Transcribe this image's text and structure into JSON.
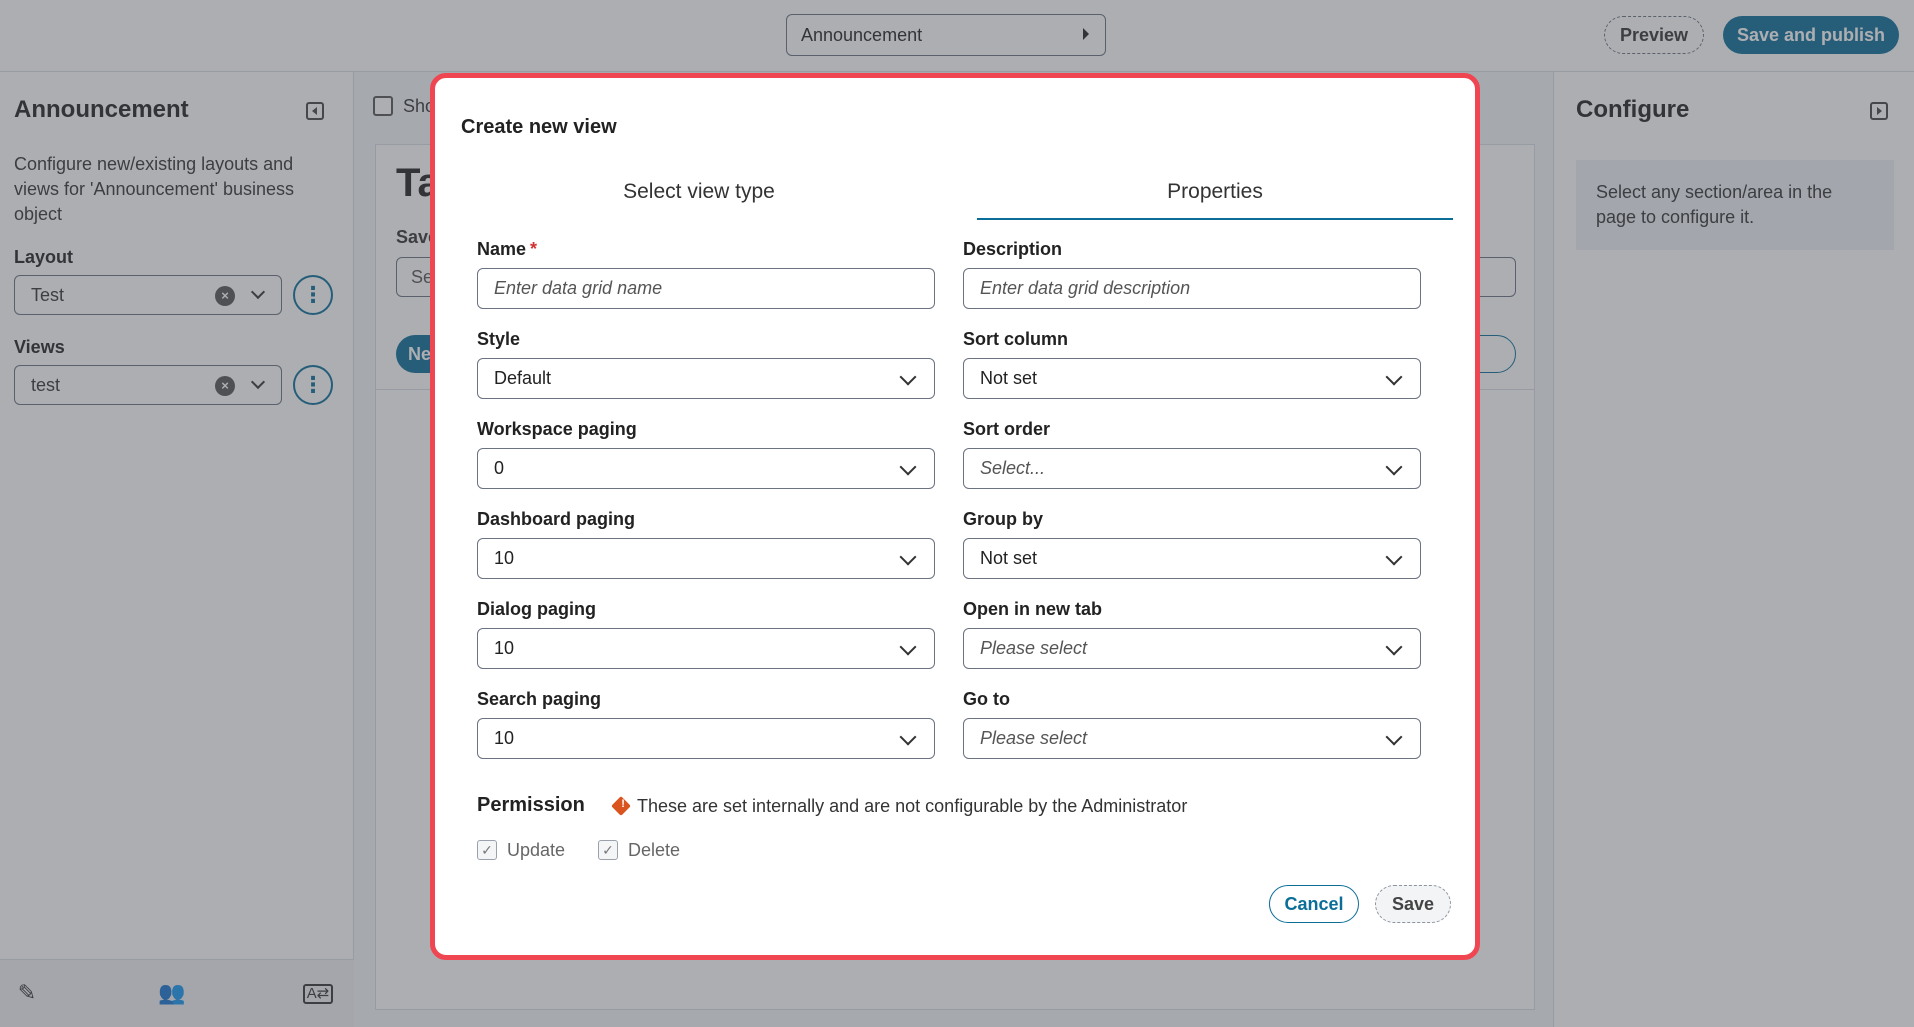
{
  "topbar": {
    "object_select": "Announcement",
    "preview_label": "Preview",
    "publish_label": "Save and publish"
  },
  "left_panel": {
    "title": "Announcement",
    "description": "Configure new/existing layouts and views for 'Announcement' business object",
    "layout_label": "Layout",
    "layout_value": "Test",
    "views_label": "Views",
    "views_value": "test"
  },
  "center": {
    "show_label": "Sho",
    "canvas_title": "Ta",
    "save_label": "Save",
    "input_value": "Se",
    "new_button": "Ne"
  },
  "right_panel": {
    "title": "Configure",
    "info": "Select any section/area in the page to configure it."
  },
  "modal": {
    "title": "Create new view",
    "tabs": {
      "view_type": "Select view type",
      "properties": "Properties"
    },
    "fields": {
      "name": {
        "label": "Name",
        "required": "*",
        "placeholder": "Enter data grid name"
      },
      "description": {
        "label": "Description",
        "placeholder": "Enter data grid description"
      },
      "style": {
        "label": "Style",
        "value": "Default"
      },
      "sort_column": {
        "label": "Sort column",
        "value": "Not set"
      },
      "workspace_paging": {
        "label": "Workspace paging",
        "value": "0"
      },
      "sort_order": {
        "label": "Sort order",
        "value": "Select..."
      },
      "dashboard_paging": {
        "label": "Dashboard paging",
        "value": "10"
      },
      "group_by": {
        "label": "Group by",
        "value": "Not set"
      },
      "dialog_paging": {
        "label": "Dialog paging",
        "value": "10"
      },
      "open_new_tab": {
        "label": "Open in new tab",
        "value": "Please select"
      },
      "search_paging": {
        "label": "Search paging",
        "value": "10"
      },
      "go_to": {
        "label": "Go to",
        "value": "Please select"
      }
    },
    "permission": {
      "title": "Permission",
      "note": "These are set internally and are not configurable by the Administrator",
      "update_label": "Update",
      "delete_label": "Delete"
    },
    "cancel_label": "Cancel",
    "save_label": "Save"
  },
  "colors": {
    "accent": "#0b6e99",
    "modal_border": "#ef4652",
    "warning": "#d9541e"
  }
}
